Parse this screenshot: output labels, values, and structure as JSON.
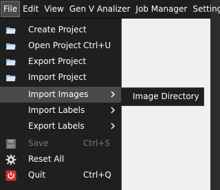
{
  "menubar": {
    "items": [
      {
        "label": "File"
      },
      {
        "label": "Edit"
      },
      {
        "label": "View"
      },
      {
        "label": "Gen V Analizer"
      },
      {
        "label": "Job Manager"
      },
      {
        "label": "Settings"
      }
    ]
  },
  "file_menu": {
    "items": [
      {
        "label": "Create Project",
        "shortcut": "",
        "icon": "folder-icon"
      },
      {
        "label": "Open Project",
        "shortcut": "Ctrl+U",
        "icon": "folder-icon"
      },
      {
        "label": "Export Project",
        "shortcut": "",
        "icon": "folder-icon"
      },
      {
        "label": "Import Project",
        "shortcut": "",
        "icon": "folder-icon"
      },
      {
        "label": "Import Images",
        "shortcut": "",
        "submenu": true
      },
      {
        "label": "Import Labels",
        "shortcut": "",
        "submenu": true
      },
      {
        "label": "Export Labels",
        "shortcut": "",
        "submenu": true
      },
      {
        "label": "Save",
        "shortcut": "Ctrl+S",
        "icon": "save-icon",
        "disabled": true
      },
      {
        "label": "Reset All",
        "shortcut": "",
        "icon": "gear-icon"
      },
      {
        "label": "Quit",
        "shortcut": "Ctrl+Q",
        "icon": "power-icon"
      }
    ]
  },
  "submenu": {
    "items": [
      {
        "label": "Image Directory"
      }
    ]
  },
  "colors": {
    "menubar_bg": "#1e1e1e",
    "menu_bg": "#1f1f1f",
    "highlight": "#4a4a4a",
    "canvas": "#f0f0f0",
    "quit_icon": "#d32f2f"
  }
}
